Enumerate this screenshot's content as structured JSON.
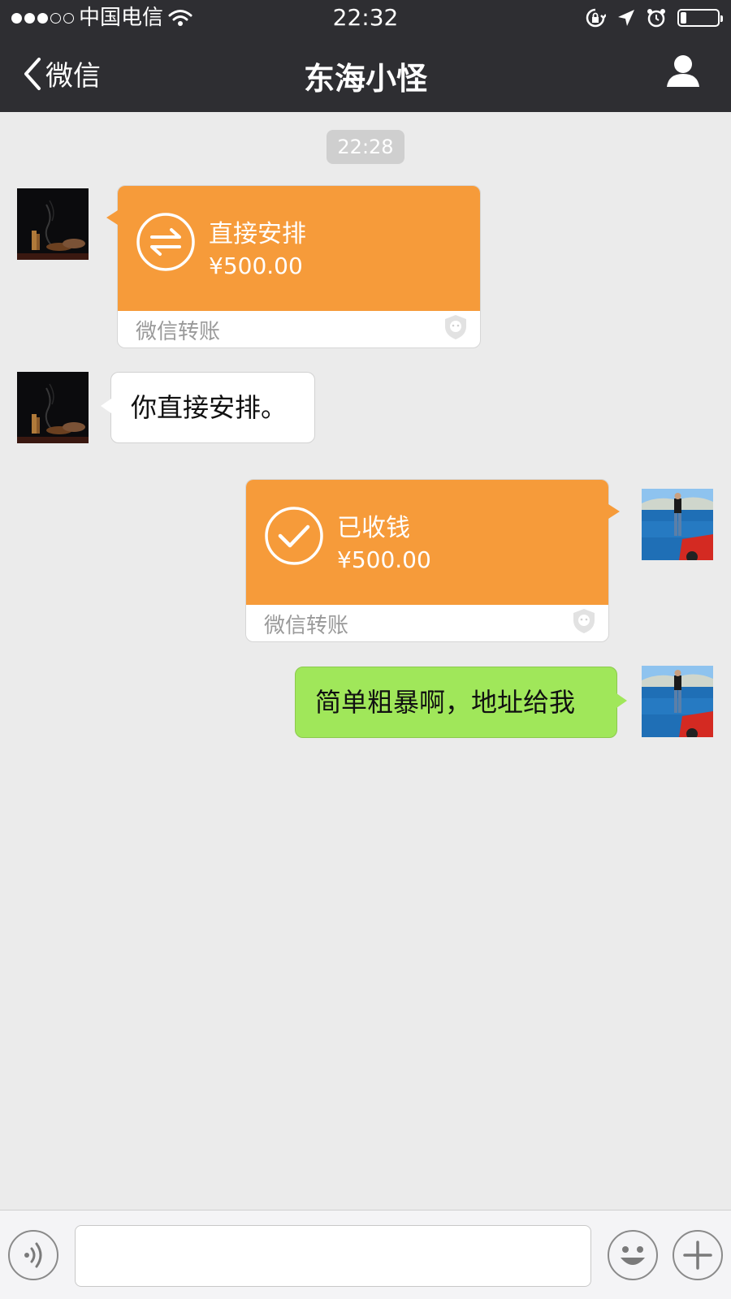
{
  "status_bar": {
    "carrier": "中国电信",
    "time": "22:32",
    "signal_bars_filled": 3,
    "signal_bars_total": 5,
    "battery_level": 0.15
  },
  "nav": {
    "back_label": "微信",
    "title": "东海小怪",
    "right_icon": "person-icon"
  },
  "chat": {
    "timestamp": "22:28",
    "messages": [
      {
        "side": "left",
        "type": "transfer",
        "title": "直接安排",
        "amount": "¥500.00",
        "footer": "微信转账",
        "icon": "transfer-arrows-icon"
      },
      {
        "side": "left",
        "type": "text",
        "text": "你直接安排。"
      },
      {
        "side": "right",
        "type": "transfer",
        "title": "已收钱",
        "amount": "¥500.00",
        "footer": "微信转账",
        "icon": "checkmark-icon"
      },
      {
        "side": "right",
        "type": "text",
        "text": "简单粗暴啊，地址给我"
      }
    ]
  },
  "input_bar": {
    "voice_icon": "voice-icon",
    "emoji_icon": "emoji-icon",
    "plus_icon": "plus-icon"
  },
  "colors": {
    "topbar": "#2e2e32",
    "transfer_orange": "#f69b3a",
    "sent_green": "#a0e75a",
    "chat_bg": "#ebebeb"
  }
}
